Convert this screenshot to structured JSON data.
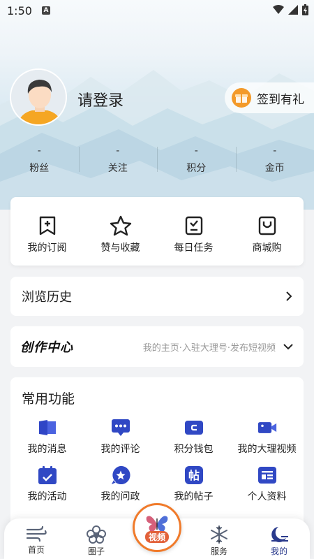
{
  "status_bar": {
    "time": "1:50",
    "badge": "A"
  },
  "profile": {
    "login_text": "请登录",
    "signin_label": "签到有礼"
  },
  "stats": [
    {
      "value": "-",
      "label": "粉丝"
    },
    {
      "value": "-",
      "label": "关注"
    },
    {
      "value": "-",
      "label": "积分"
    },
    {
      "value": "-",
      "label": "金币"
    }
  ],
  "quick_actions": [
    {
      "label": "我的订阅",
      "icon": "bookmark-plus-icon"
    },
    {
      "label": "赞与收藏",
      "icon": "star-icon"
    },
    {
      "label": "每日任务",
      "icon": "task-checklist-icon"
    },
    {
      "label": "商城购",
      "icon": "shopping-bag-icon"
    }
  ],
  "history": {
    "label": "浏览历史"
  },
  "creator": {
    "title": "创作中心",
    "subtitle": "我的主页·入驻大理号·发布短视频"
  },
  "common": {
    "title": "常用功能",
    "items": [
      {
        "label": "我的消息",
        "icon": "message-icon"
      },
      {
        "label": "我的评论",
        "icon": "comment-icon"
      },
      {
        "label": "积分钱包",
        "icon": "wallet-icon"
      },
      {
        "label": "我的大理视频",
        "icon": "video-camera-icon"
      },
      {
        "label": "我的活动",
        "icon": "calendar-icon"
      },
      {
        "label": "我的问政",
        "icon": "question-star-icon"
      },
      {
        "label": "我的帖子",
        "icon": "post-icon"
      },
      {
        "label": "个人资料",
        "icon": "profile-card-icon"
      }
    ],
    "post_glyph": "帖"
  },
  "nav": {
    "home": "首页",
    "circle": "圈子",
    "video": "视频",
    "service": "服务",
    "mine": "我的"
  },
  "colors": {
    "accent": "#3048c4",
    "orange": "#f07a2a",
    "active_nav": "#2a3a8c"
  }
}
